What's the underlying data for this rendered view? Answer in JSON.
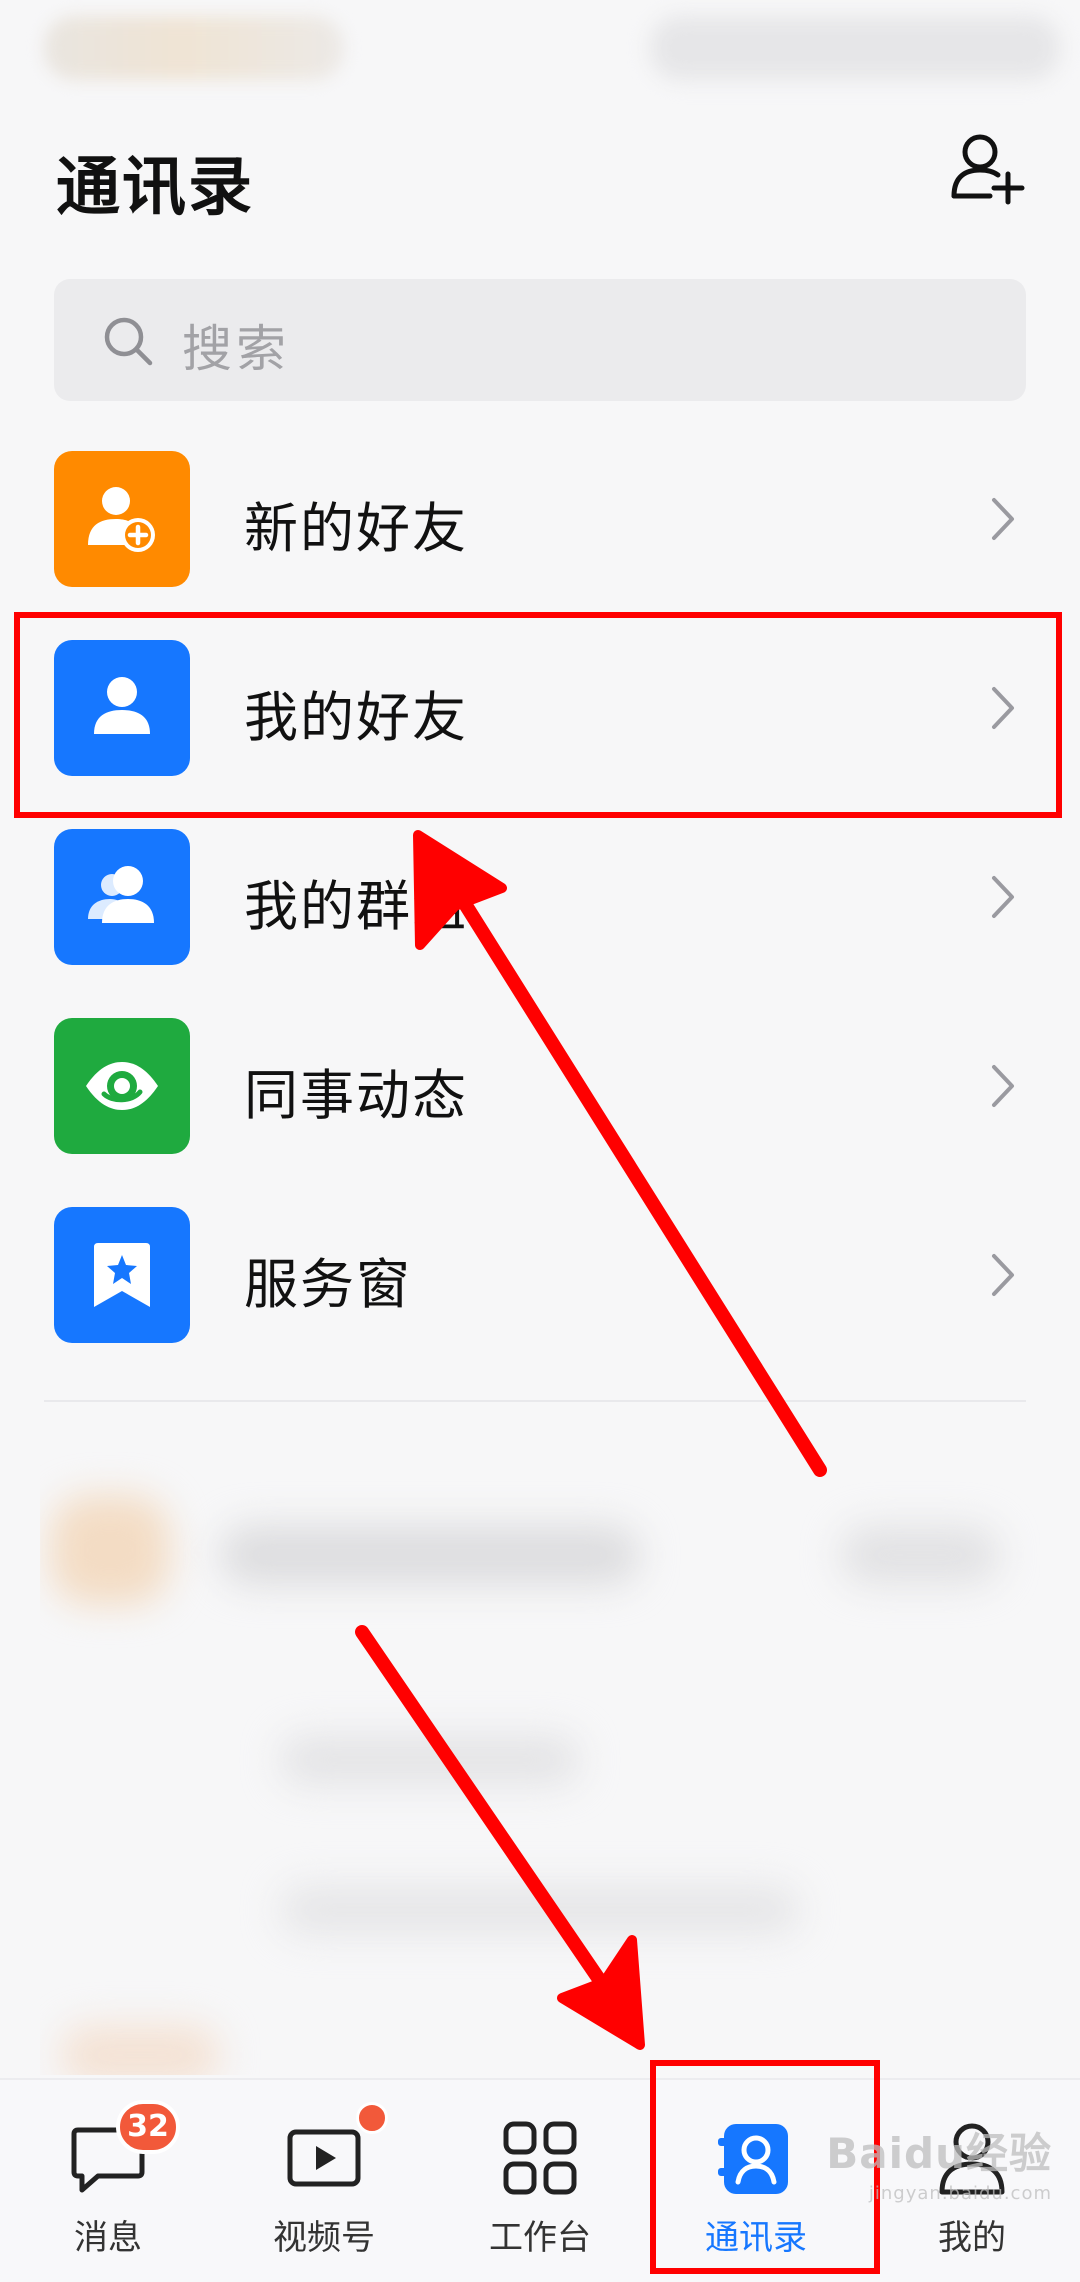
{
  "header": {
    "title": "通讯录"
  },
  "search": {
    "placeholder": "搜索"
  },
  "menu": [
    {
      "label": "新的好友",
      "icon": "add-friend-icon",
      "color": "#ff8a00"
    },
    {
      "label": "我的好友",
      "icon": "person-icon",
      "color": "#1677ff"
    },
    {
      "label": "我的群组",
      "icon": "group-icon",
      "color": "#1677ff"
    },
    {
      "label": "同事动态",
      "icon": "eye-icon",
      "color": "#1faa3f"
    },
    {
      "label": "服务窗",
      "icon": "bookmark-star-icon",
      "color": "#1677ff"
    }
  ],
  "tabs": [
    {
      "label": "消息",
      "icon": "chat-bubble-icon",
      "badge": "32"
    },
    {
      "label": "视频号",
      "icon": "video-play-icon",
      "dot": true
    },
    {
      "label": "工作台",
      "icon": "grid-apps-icon"
    },
    {
      "label": "通讯录",
      "icon": "contacts-book-icon",
      "active": true
    },
    {
      "label": "我的",
      "icon": "user-profile-icon"
    }
  ],
  "annotation_color": "#ff0000",
  "watermark": {
    "text": "Baidu经验",
    "sub": "jingyan.baidu.com"
  }
}
